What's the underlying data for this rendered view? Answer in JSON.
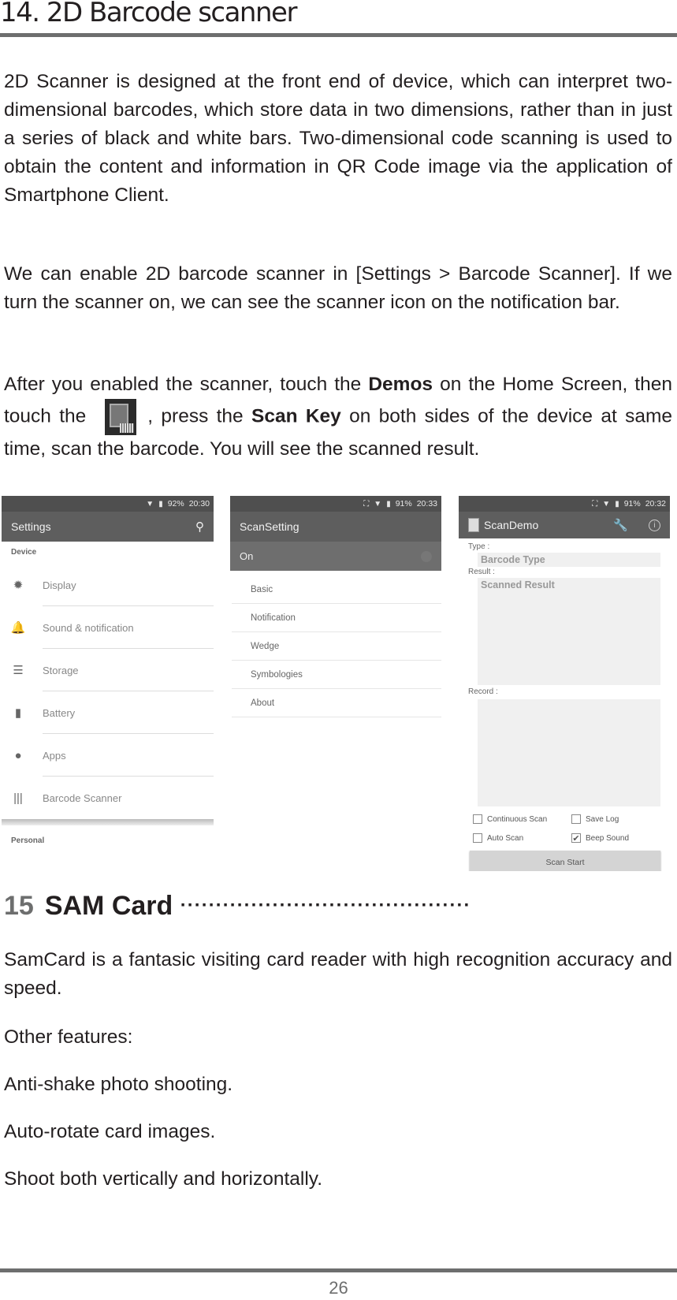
{
  "chapter": {
    "title": "14. 2D Barcode scanner"
  },
  "paragraphs": {
    "p1": "2D Scanner is designed at the front end of device, which can interpret two-dimensional barcodes, which store data in two dimensions, rather than in just a series of black and white bars. Two-dimensional code scanning is used to obtain the content and information in QR Code image via the application of Smartphone Client.",
    "p2": "We can enable 2D barcode scanner in [Settings > Barcode Scanner]. If we turn the scanner on, we can see the scanner icon on the notification bar.",
    "p3": {
      "part1": "After you enabled the scanner, touch the ",
      "bold1": "Demos",
      "part2": " on the Home Screen, then touch the",
      "part3": ", press the ",
      "bold2": "Scan Key",
      "part4": " on both sides of the device at same time, scan the barcode.  You will see the scanned result."
    }
  },
  "screens": {
    "settings": {
      "status": {
        "battery": "92%",
        "time": "20:30"
      },
      "title": "Settings",
      "section_device": "Device",
      "items": [
        {
          "icon": "brightness-icon",
          "glyph": "✹",
          "label": "Display"
        },
        {
          "icon": "bell-icon",
          "glyph": "🔔",
          "label": "Sound & notification"
        },
        {
          "icon": "storage-icon",
          "glyph": "☰",
          "label": "Storage"
        },
        {
          "icon": "battery-icon",
          "glyph": "▮",
          "label": "Battery"
        },
        {
          "icon": "android-icon",
          "glyph": "●",
          "label": "Apps"
        },
        {
          "icon": "barcode-icon",
          "glyph": "|||",
          "label": "Barcode Scanner"
        }
      ],
      "section_personal": "Personal"
    },
    "scansetting": {
      "status": {
        "battery": "91%",
        "time": "20:33"
      },
      "title": "ScanSetting",
      "toggle_label": "On",
      "items": [
        "Basic",
        "Notification",
        "Wedge",
        "Symbologies",
        "About"
      ]
    },
    "scandemo": {
      "status": {
        "battery": "91%",
        "time": "20:32"
      },
      "title": "ScanDemo",
      "type_label": "Type :",
      "type_value": "Barcode Type",
      "result_label": "Result :",
      "result_value": "Scanned Result",
      "record_label": "Record :",
      "checkboxes": [
        {
          "label": "Continuous Scan",
          "checked": false
        },
        {
          "label": "Save Log",
          "checked": false
        },
        {
          "label": "Auto Scan",
          "checked": false
        },
        {
          "label": "Beep Sound",
          "checked": true
        }
      ],
      "button": "Scan Start"
    }
  },
  "section15": {
    "number": "15",
    "title": "SAM Card",
    "leader": "·········································",
    "paragraphs": [
      "SamCard is a fantasic visiting card reader with high recognition accuracy and speed.",
      "Other features:",
      "Anti-shake photo shooting.",
      "Auto-rotate card images.",
      "Shoot both vertically and horizontally."
    ]
  },
  "footer": {
    "page_number": "26"
  }
}
